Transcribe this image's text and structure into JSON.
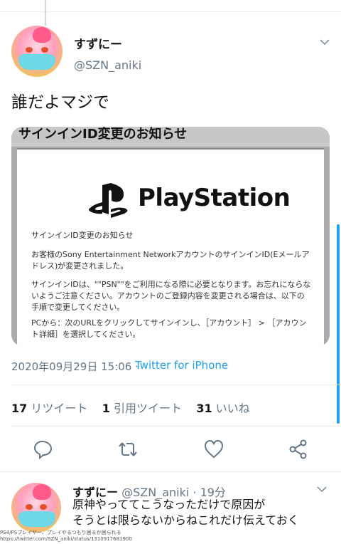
{
  "main_tweet": {
    "author_name": "すずにー",
    "author_handle": "@SZN_aniki",
    "text": "誰だよマジで",
    "media": {
      "header": "サインインID変更のお知らせ",
      "brand": "PlayStation",
      "lines": [
        "サインインID変更のお知らせ",
        "お客様のSony Entertainment NetworkアカウントのサインインID(Eメールアドレス)が変更されました。",
        "サインインIDは、\"\"PSN\"\"をご利用になる際に必要となります。お忘れにならないようご注意ください。アカウントのご登録内容を変更される場合は、以下の手順で変更してください。",
        "PCから：次のURLをクリックしてサインインし、［アカウント］ > ［アカウント詳細］を選択してください。"
      ]
    },
    "timestamp": "2020年09月29日 15:06",
    "separator": "·",
    "via": "Twitter for iPhone",
    "stats": {
      "retweets_count": "17",
      "retweets_label": "リツイート",
      "quotes_count": "1",
      "quotes_label": "引用ツイート",
      "likes_count": "31",
      "likes_label": "いいね"
    }
  },
  "reply_tweet": {
    "author_name": "すずにー",
    "author_handle": "@SZN_aniki",
    "time": "· 19分",
    "line1": "原神やっててこうなっただけで原因が",
    "line2": "そうとは限らないからねこれだけ伝えておく"
  },
  "watermark": {
    "line1": "PS4/PSプレイヤー、プレイやるつもり居るか居られる",
    "line2": "https://twitter.com/SZN_aniki/status/1310917681900"
  },
  "colors": {
    "accent": "#1da1f2",
    "secondary_text": "#657786",
    "divider": "#e6ecf0"
  }
}
